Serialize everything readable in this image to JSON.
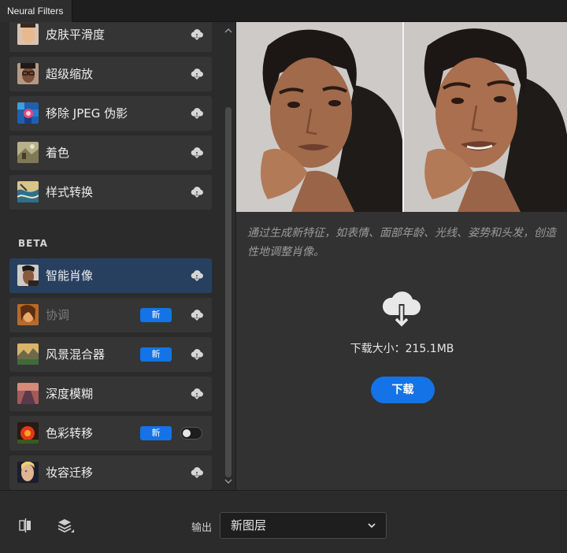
{
  "window": {
    "tab_title": "Neural Filters"
  },
  "filters": [
    {
      "label": "皮肤平滑度",
      "thumb": "face-portrait-icon",
      "status": "cloud-download"
    },
    {
      "label": "超级缩放",
      "thumb": "face-glasses-icon",
      "status": "cloud-download"
    },
    {
      "label": "移除 JPEG 伪影",
      "thumb": "artifact-icon",
      "status": "cloud-download"
    },
    {
      "label": "着色",
      "thumb": "colorize-icon",
      "status": "cloud-download"
    },
    {
      "label": "样式转换",
      "thumb": "style-icon",
      "status": "cloud-download"
    }
  ],
  "beta": {
    "title": "BETA",
    "items": [
      {
        "label": "智能肖像",
        "selected": true,
        "status": "cloud-download"
      },
      {
        "label": "协调",
        "dimmed": true,
        "badge": "新",
        "status": "cloud-download"
      },
      {
        "label": "风景混合器",
        "badge": "新",
        "status": "cloud-download"
      },
      {
        "label": "深度模糊",
        "status": "cloud-download"
      },
      {
        "label": "色彩转移",
        "badge": "新",
        "status": "toggle-off"
      },
      {
        "label": "妆容迁移",
        "status": "cloud-download"
      }
    ]
  },
  "detail": {
    "description": "通过生成新特征，如表情、面部年龄、光线、姿势和头发，创造性地调整肖像。",
    "download_size": "下载大小：215.1MB",
    "download_button": "下载"
  },
  "footer": {
    "output_label": "输出",
    "output_value": "新图层"
  },
  "colors": {
    "accent": "#1473e6",
    "selected": "#284060",
    "item_bg": "#353535"
  }
}
